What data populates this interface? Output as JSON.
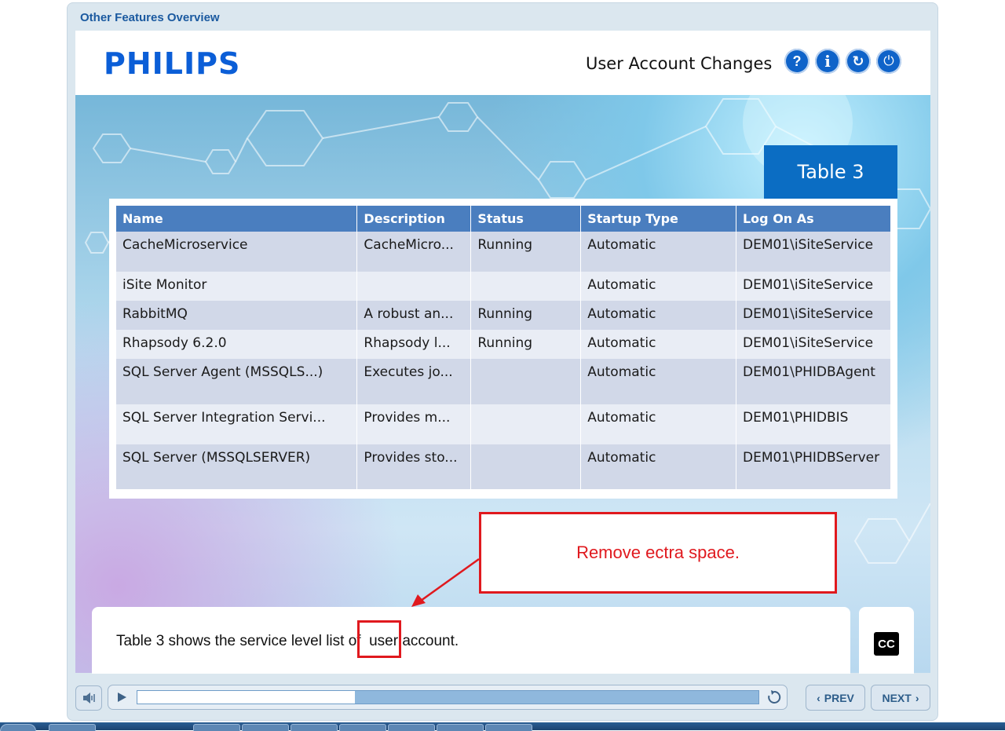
{
  "course": {
    "title": "Other Features Overview"
  },
  "header": {
    "logo": "PHILIPS",
    "page_title": "User Account Changes",
    "buttons": [
      {
        "name": "help",
        "glyph": "?"
      },
      {
        "name": "info",
        "glyph": "i"
      },
      {
        "name": "restart",
        "glyph": "↻"
      },
      {
        "name": "exit",
        "glyph": "⏻"
      }
    ]
  },
  "content": {
    "tab_label": "Table 3",
    "table": {
      "columns": [
        "Name",
        "Description",
        "Status",
        "Startup Type",
        "Log On As"
      ],
      "rows": [
        [
          "CacheMicroservice",
          "CacheMicro...",
          "Running",
          "Automatic",
          "DEM01\\iSiteService"
        ],
        [
          "iSite Monitor",
          "",
          "",
          "Automatic",
          "DEM01\\iSiteService"
        ],
        [
          "RabbitMQ",
          "A robust an...",
          "Running",
          "Automatic",
          "DEM01\\iSiteService"
        ],
        [
          "Rhapsody 6.2.0",
          "Rhapsody l...",
          "Running",
          "Automatic",
          "DEM01\\iSiteService"
        ],
        [
          "SQL Server Agent (MSSQLS...)",
          "Executes jo...",
          "",
          "Automatic",
          "DEM01\\PHIDBAgent"
        ],
        [
          "SQL Server Integration Servi...",
          "Provides m...",
          "",
          "Automatic",
          "DEM01\\PHIDBIS"
        ],
        [
          "SQL Server (MSSQLSERVER)",
          "Provides sto...",
          "",
          "Automatic",
          "DEM01\\PHIDBServer"
        ]
      ]
    }
  },
  "annotation": {
    "callout_text": "Remove ectra space.",
    "color": "#e0191e"
  },
  "caption": {
    "text": "Table 3 shows the service level list of  user account.",
    "cc_label": "CC"
  },
  "controls": {
    "prev_label": "PREV",
    "next_label": "NEXT",
    "progress_fraction": 0.35
  },
  "colors": {
    "accent": "#0b6dc3",
    "header_row": "#4a7ebf",
    "brand": "#0b5ed7"
  }
}
